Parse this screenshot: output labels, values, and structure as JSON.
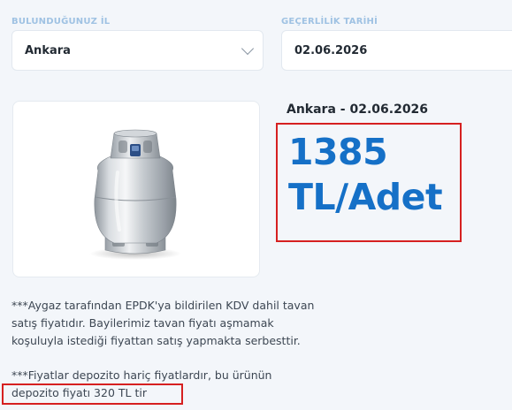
{
  "filters": {
    "city_label": "BULUNDUĞUNUZ İL",
    "city_value": "Ankara",
    "date_label": "GEÇERLİLİK TARİHİ",
    "date_value": "02.06.2026"
  },
  "product": {
    "image_icon": "gas-cylinder-icon"
  },
  "price": {
    "heading": "Ankara - 02.06.2026",
    "value": "1385",
    "unit": "TL/Adet",
    "highlight_color": "#d62020",
    "value_color": "#1570c7"
  },
  "notes": {
    "note1_line1": "***Aygaz tarafından EPDK'ya bildirilen KDV dahil tavan",
    "note1_line2": "satış fiyatıdır. Bayilerimiz tavan fiyatı aşmamak",
    "note1_line3": "koşuluyla istediği fiyattan satış yapmakta serbesttir.",
    "note2_line1": "***Fiyatlar depozito hariç fiyatlardır, bu ürünün",
    "note2_line2": "depozito fiyatı 320 TL tir"
  }
}
